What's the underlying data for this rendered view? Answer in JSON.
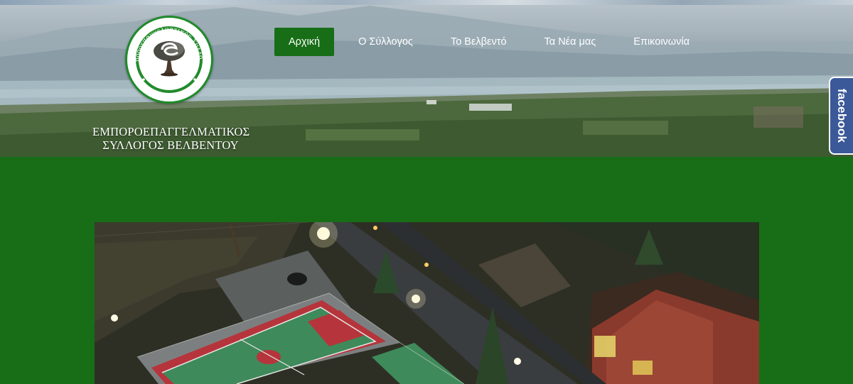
{
  "logo": {
    "ring_text": "Εμποροεπαγγελματικός Σύλλογος",
    "bottom_text": "Βελβεντού",
    "icon": "tree-with-e-leaf-icon"
  },
  "brand": {
    "line1": "ΕΜΠΟΡΟΕΠΑΓΓΕΛΜΑΤΙΚΟΣ",
    "line2": "ΣΥΛΛΟΓΟΣ ΒΕΛΒΕΝΤΟΥ"
  },
  "nav": {
    "items": [
      {
        "label": "Αρχική",
        "active": true
      },
      {
        "label": "Ο Σύλλογος",
        "active": false
      },
      {
        "label": "Το Βελβεντό",
        "active": false
      },
      {
        "label": "Τα Νέα μας",
        "active": false
      },
      {
        "label": "Επικοινωνία",
        "active": false
      }
    ]
  },
  "facebook_tab": {
    "label": "facebook",
    "icon": "facebook-icon"
  },
  "colors": {
    "primary_green": "#176e16",
    "facebook_blue": "#3b5998",
    "court_green": "#3f8a5a",
    "court_red": "#b6343b"
  },
  "hero_photo": {
    "subject": "lake-valley-panorama"
  },
  "main_photo": {
    "subject": "night-aerial-sports-courts"
  }
}
